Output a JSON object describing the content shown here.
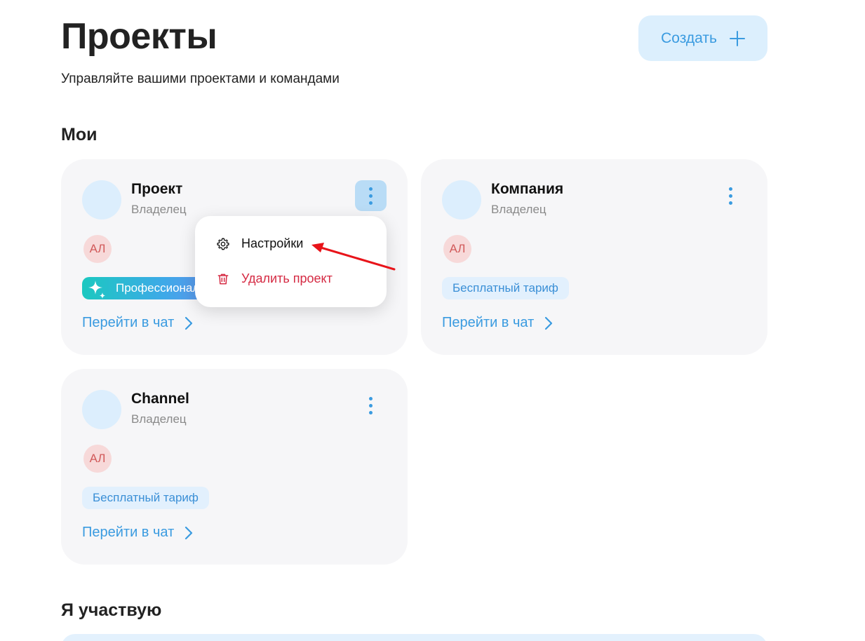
{
  "header": {
    "title": "Проекты",
    "subtitle": "Управляйте вашими проектами и командами",
    "create_label": "Создать"
  },
  "sections": {
    "my": "Мои",
    "participate": "Я участвую"
  },
  "cards": [
    {
      "name": "Проект",
      "role": "Владелец",
      "member_initials": "АЛ",
      "plan": "Профессиональный",
      "plan_type": "pro",
      "chat_link": "Перейти в чат",
      "menu_open": true
    },
    {
      "name": "Компания",
      "role": "Владелец",
      "member_initials": "АЛ",
      "plan": "Бесплатный тариф",
      "plan_type": "free",
      "chat_link": "Перейти в чат",
      "menu_open": false
    },
    {
      "name": "Channel",
      "role": "Владелец",
      "member_initials": "АЛ",
      "plan": "Бесплатный тариф",
      "plan_type": "free",
      "chat_link": "Перейти в чат",
      "menu_open": false
    }
  ],
  "dropdown": {
    "settings_label": "Настройки",
    "delete_label": "Удалить проект"
  },
  "colors": {
    "accent": "#3a9be0",
    "danger": "#d52a43",
    "annotation_arrow": "#e8141a"
  }
}
